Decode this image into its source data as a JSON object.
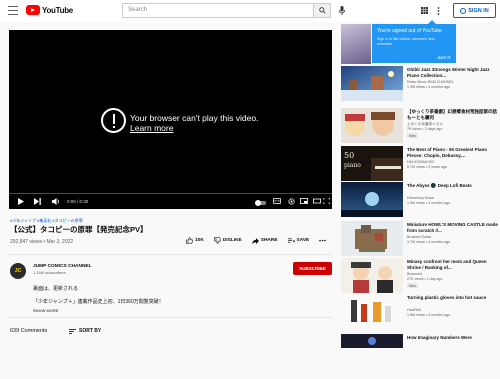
{
  "header": {
    "logo_text": "YouTube",
    "search_placeholder": "Search",
    "signin_label": "SIGN IN"
  },
  "tooltip": {
    "title": "You're signed out of YouTube",
    "body": "Sign in to like videos, comment, and subscribe.",
    "button": "GOT IT"
  },
  "player": {
    "error_line1": "Your browser can't play this video.",
    "error_link": "Learn more",
    "time": "0:00 / 0:30"
  },
  "video": {
    "hashtags": "#少年ジャンプ #集英社 #タコピーの原罪",
    "title": "【公式】タコピーの原罪【発売記念PV】",
    "views": "292,847 views • Mar 3, 2022",
    "likes": "10K",
    "dislike": "DISLIKE",
    "share": "SHARE",
    "save": "SAVE"
  },
  "channel": {
    "name": "JUMP COMICS CHANNEL",
    "subscribers": "1.15M subscribers",
    "avatar_text": "JC",
    "subscribe": "SUBSCRIBE"
  },
  "description": {
    "line1": "裏面は、更新される",
    "line2": "「少年ジャンプ＋」連載作品史上初、1日360万閲覧突破！",
    "show_more": "SHOW MORE"
  },
  "comments": {
    "count": "639 Comments",
    "sort": "SORT BY"
  },
  "related": [
    {
      "title": "Ghibli Jazz 3Snongs Winter Night Jazz Piano Collection...",
      "channel": "Relax Music BGM CHANNEL",
      "meta": "1.9M views • 4 months ago",
      "duration": "",
      "badge": ""
    },
    {
      "title": "【ゆっくり茶番劇】幻想郷食材荒独話第の話もーとも麗司",
      "channel": "上のくの化番茶ャネル",
      "meta": "7K views • 2 days ago",
      "duration": "",
      "badge": "New"
    },
    {
      "title": "The Best of Piano - 50 Greatest Piano Pieces: Chopin, Debussy,...",
      "channel": "HALIDONMUSIC",
      "meta": "5.7M views • 2 years ago",
      "duration": "",
      "badge": ""
    },
    {
      "title": "The Abyss 🌑 Deep Lofi Beats",
      "channel": "Dreamhop Music",
      "meta": "1.9M views • 4 months ago",
      "duration": "",
      "badge": ""
    },
    {
      "title": "Miniature HOWL'S MOVING CASTLE made from scratch //...",
      "channel": "Brushed Guitar",
      "meta": "3.7M views • 4 months ago",
      "duration": "",
      "badge": ""
    },
    {
      "title": "Minasy confront her mom and Queen Shrine / Ranking of...",
      "channel": "Beaworld",
      "meta": "27K views • 1 day ago",
      "duration": "",
      "badge": "New"
    },
    {
      "title": "Turning plastic gloves into hot sauce",
      "channel": "HowRelt",
      "meta": "1.8M views • 6 months ago",
      "duration": "",
      "badge": ""
    },
    {
      "title": "How Imaginary Numbers Were",
      "channel": "",
      "meta": "",
      "duration": "",
      "badge": ""
    }
  ],
  "colors": {
    "brand_red": "#ff0000",
    "link_blue": "#065fd4",
    "subscribe_red": "#cc0000",
    "tooltip_blue": "#2196f3"
  }
}
